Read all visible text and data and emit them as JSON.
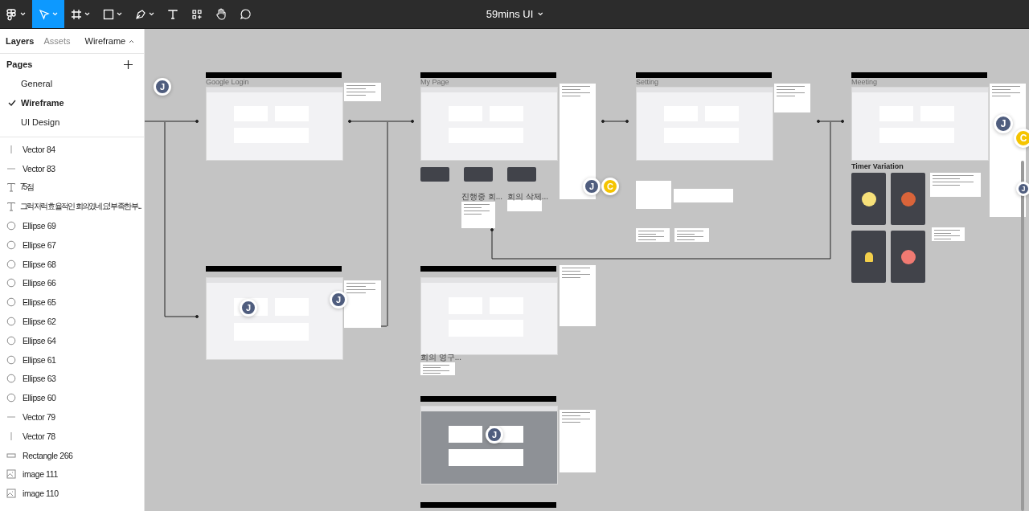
{
  "toolbar": {
    "tools": [
      {
        "kind": "main-menu",
        "selected": false
      },
      {
        "kind": "move",
        "selected": true
      },
      {
        "kind": "frame",
        "selected": false
      },
      {
        "kind": "shape",
        "selected": false
      },
      {
        "kind": "pen",
        "selected": false
      },
      {
        "kind": "text",
        "selected": false
      },
      {
        "kind": "resources",
        "selected": false
      },
      {
        "kind": "hand",
        "selected": false
      },
      {
        "kind": "comment",
        "selected": false
      }
    ],
    "file_title": "59mins UI"
  },
  "sidebar": {
    "tabs": [
      {
        "label": "Layers",
        "selected": true
      },
      {
        "label": "Assets",
        "selected": false
      }
    ],
    "page_switcher": "Wireframe",
    "pages_heading": "Pages",
    "pages": [
      {
        "name": "General",
        "selected": false
      },
      {
        "name": "Wireframe",
        "selected": true
      },
      {
        "name": "UI Design",
        "selected": false
      }
    ],
    "layers": [
      {
        "kind": "vector-vertical",
        "name": "Vector 84"
      },
      {
        "kind": "vector-horizontal",
        "name": "Vector 83"
      },
      {
        "kind": "text",
        "name": "75점"
      },
      {
        "kind": "text",
        "name": "그럭저럭 효율적인 회의였네요! 부족한 부..."
      },
      {
        "kind": "ellipse",
        "name": "Ellipse 69"
      },
      {
        "kind": "ellipse",
        "name": "Ellipse 67"
      },
      {
        "kind": "ellipse",
        "name": "Ellipse 68"
      },
      {
        "kind": "ellipse",
        "name": "Ellipse 66"
      },
      {
        "kind": "ellipse",
        "name": "Ellipse 65"
      },
      {
        "kind": "ellipse",
        "name": "Ellipse 62"
      },
      {
        "kind": "ellipse",
        "name": "Ellipse 64"
      },
      {
        "kind": "ellipse",
        "name": "Ellipse 61"
      },
      {
        "kind": "ellipse",
        "name": "Ellipse 63"
      },
      {
        "kind": "ellipse",
        "name": "Ellipse 60"
      },
      {
        "kind": "vector-horizontal",
        "name": "Vector 79"
      },
      {
        "kind": "vector-vertical",
        "name": "Vector 78"
      },
      {
        "kind": "rectangle",
        "name": "Rectangle 266"
      },
      {
        "kind": "image",
        "name": "image 111"
      },
      {
        "kind": "image",
        "name": "image 110"
      }
    ]
  },
  "canvas": {
    "frame_labels": [
      "Google Login",
      "My Page",
      "Setting",
      "Meeting"
    ],
    "group_labels": [
      "진행중 회...",
      "회의 삭제...",
      "회의 영구..."
    ],
    "section_label": "Timer Variation",
    "avatars": [
      {
        "initial": "J",
        "color": "#4f5d7e"
      },
      {
        "initial": "J",
        "color": "#4f5d7e"
      },
      {
        "initial": "C",
        "color": "#f5c400"
      },
      {
        "initial": "J",
        "color": "#4f5d7e"
      },
      {
        "initial": "C",
        "color": "#f5c400"
      },
      {
        "initial": "J",
        "color": "#4f5d7e"
      },
      {
        "initial": "J",
        "color": "#4f5d7e"
      },
      {
        "initial": "J",
        "color": "#4f5d7e"
      },
      {
        "initial": "J",
        "color": "#4f5d7e"
      }
    ]
  }
}
